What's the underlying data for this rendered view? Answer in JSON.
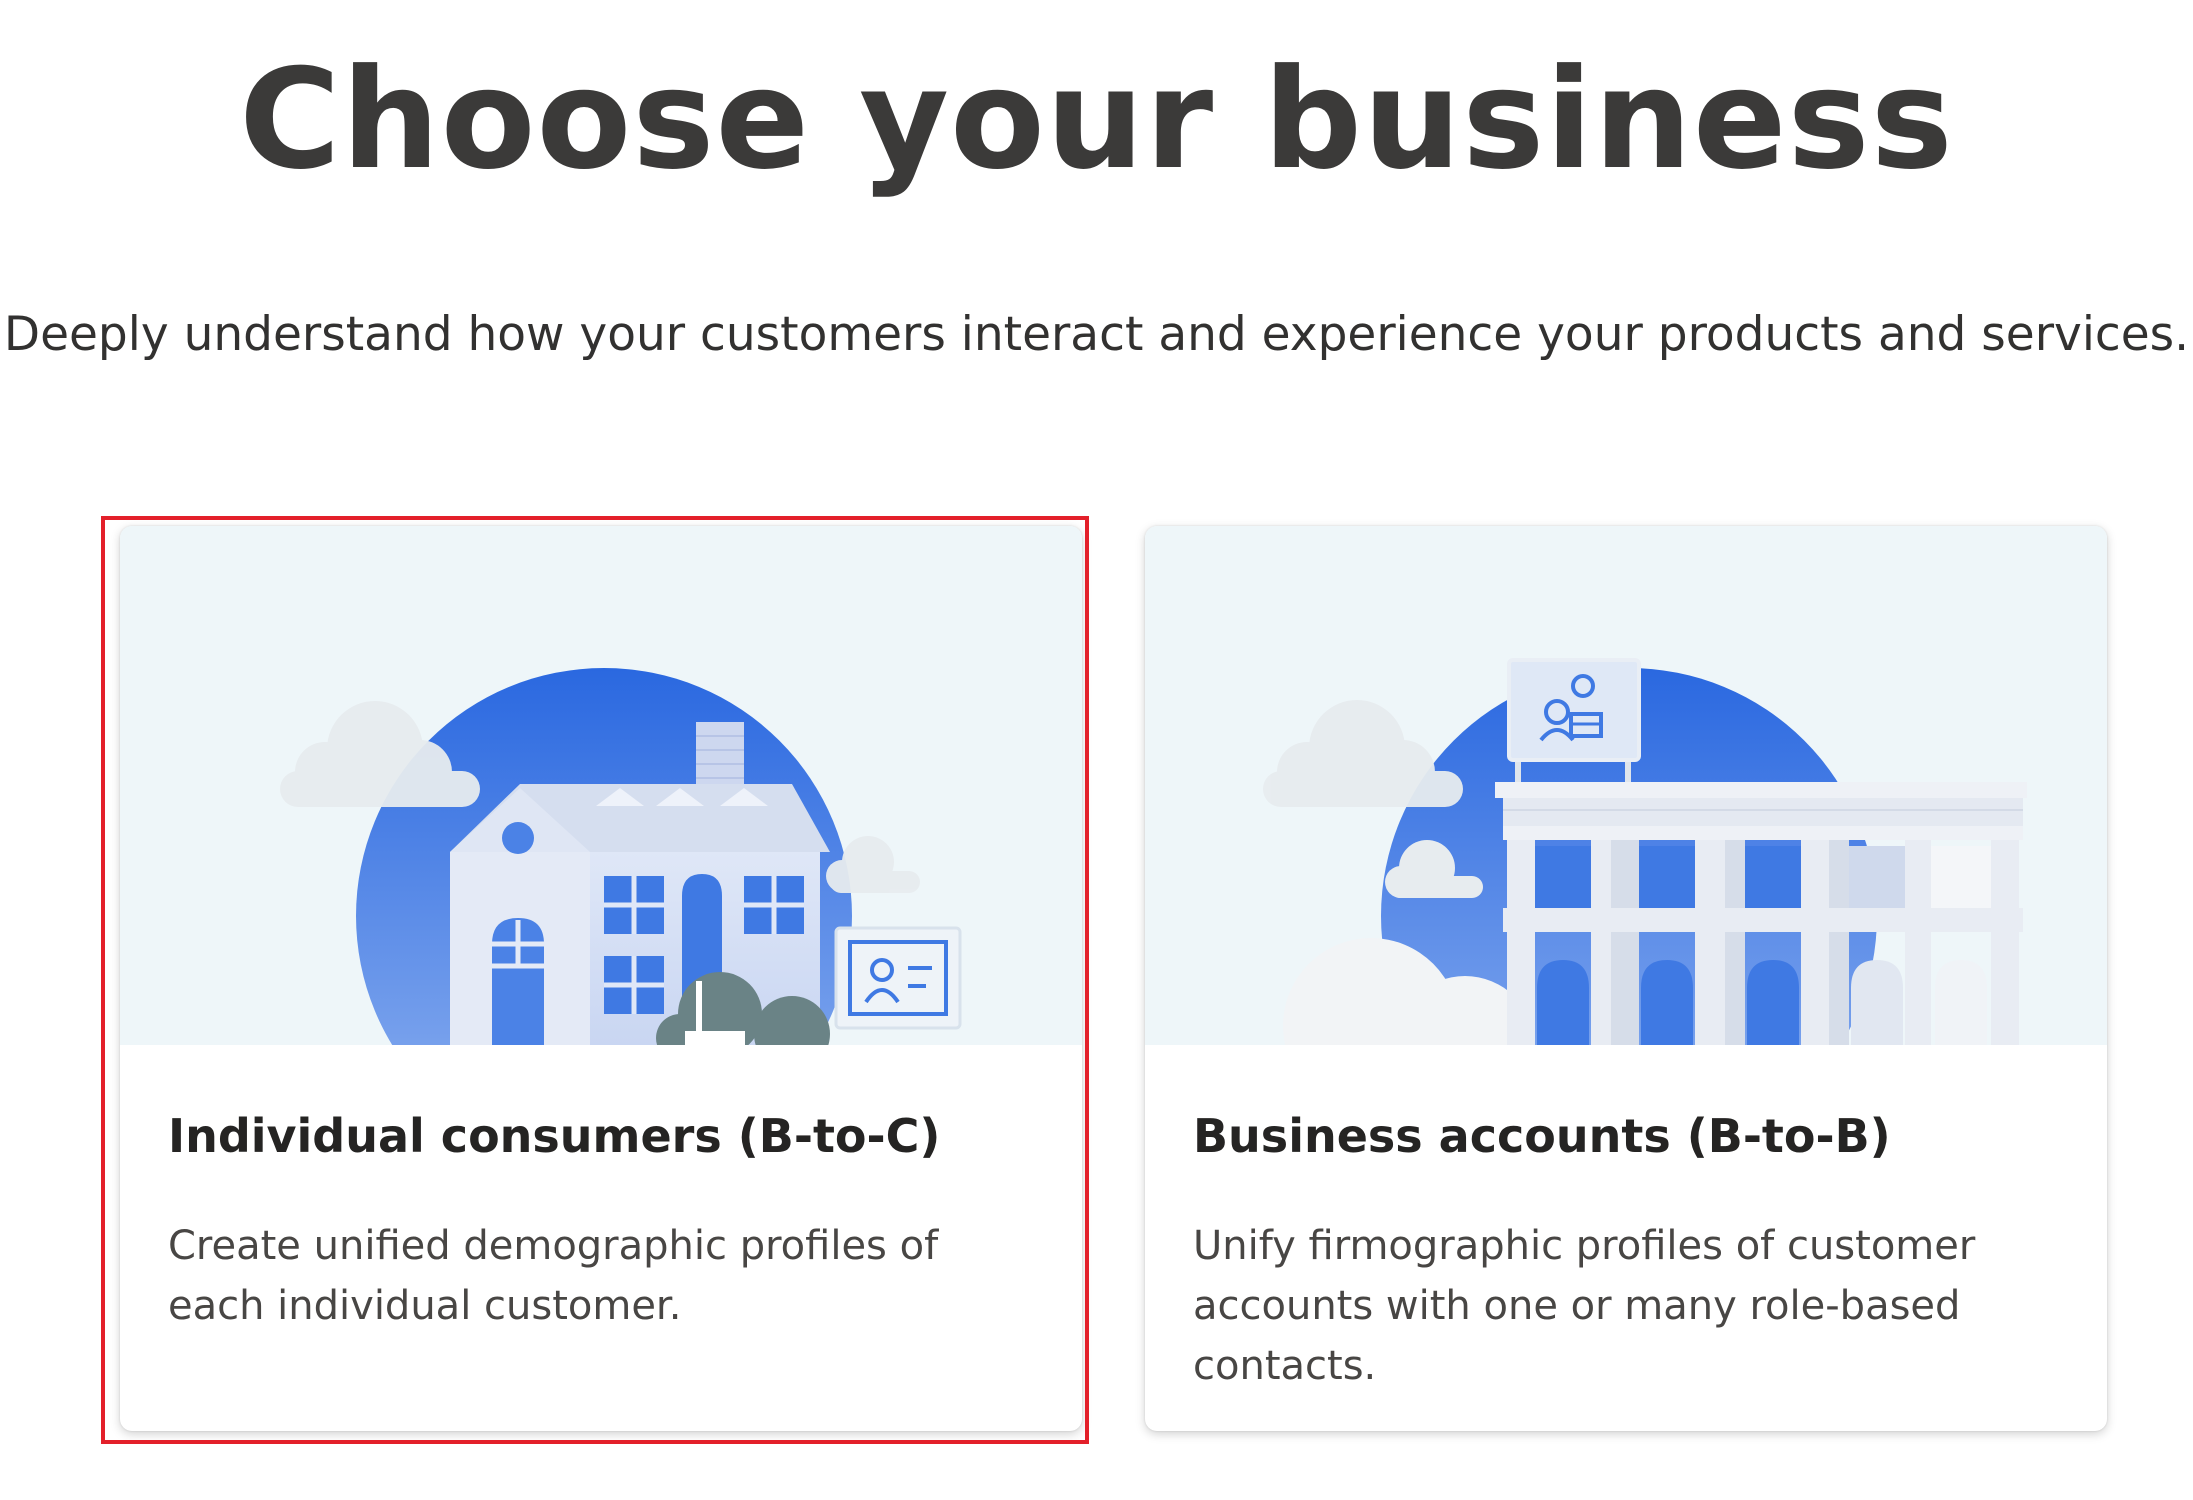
{
  "page": {
    "title": "Choose your business",
    "subtitle": "Deeply understand how your customers interact and experience your products and services."
  },
  "cards": [
    {
      "title": "Individual consumers (B-to-C)",
      "description": "Create unified demographic profiles of each individual customer.",
      "illustration": "house-illustration",
      "selected": true
    },
    {
      "title": "Business accounts (B-to-B)",
      "description": "Unify firmographic profiles of customer accounts with one or many role-based contacts.",
      "illustration": "office-building-illustration",
      "selected": false
    }
  ],
  "colors": {
    "selection_outline": "#e3202a",
    "illustration_blue": "#2f6fe0",
    "card_art_background": "#eef6f9",
    "title_text": "#3b3a39"
  }
}
